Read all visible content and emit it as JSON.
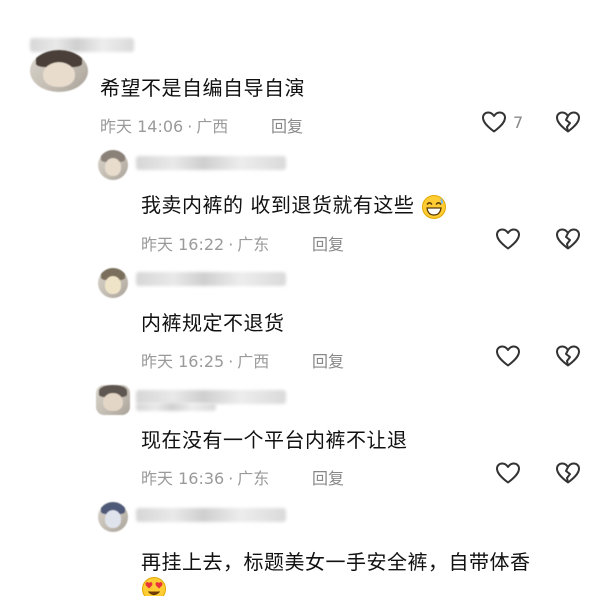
{
  "comments": [
    {
      "text": "希望不是自编自导自演",
      "time": "昨天 14:06",
      "location": "广西",
      "reply_label": "回复",
      "like_count": "7"
    },
    {
      "text": "我卖内裤的 收到退货就有这些",
      "emoji": "grinning-sweat-emoji",
      "time": "昨天 16:22",
      "location": "广东",
      "reply_label": "回复"
    },
    {
      "text": "内裤规定不退货",
      "time": "昨天 16:25",
      "location": "广西",
      "reply_label": "回复"
    },
    {
      "text": "现在没有一个平台内裤不让退",
      "time": "昨天 16:36",
      "location": "广东",
      "reply_label": "回复"
    },
    {
      "text": "再挂上去，标题美女一手安全裤，自带体香",
      "emoji": "heart-eyes-emoji"
    }
  ],
  "separator": "·",
  "icons": {
    "like": "heart-outline-icon",
    "dislike": "broken-heart-icon"
  },
  "colors": {
    "text": "#111111",
    "meta": "#9a9a9a",
    "icon": "#333333"
  }
}
